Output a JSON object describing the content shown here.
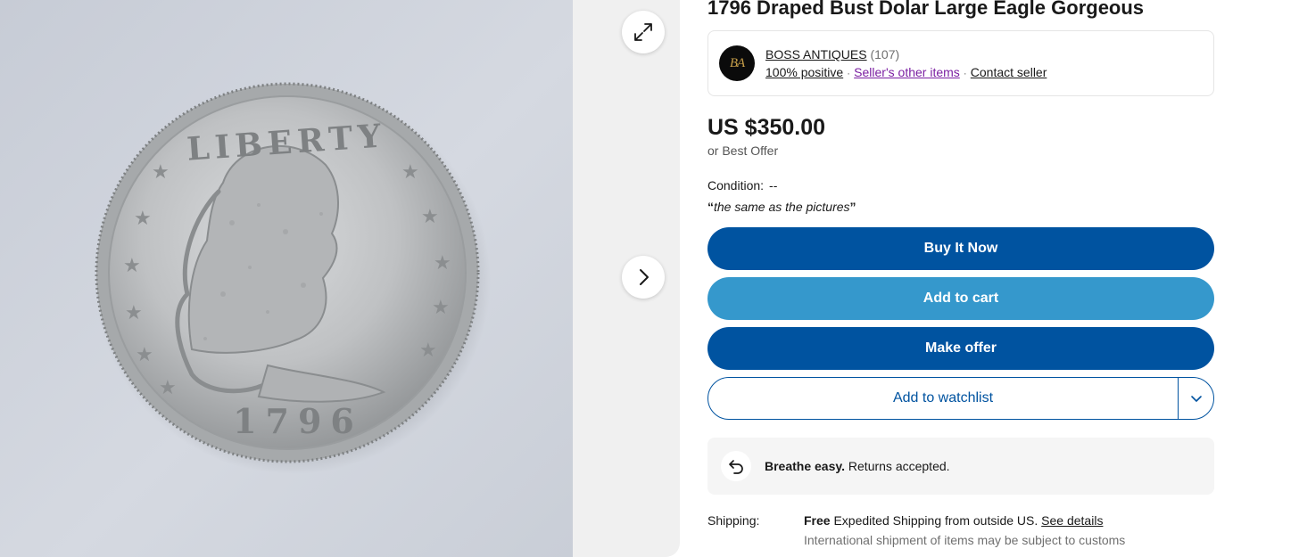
{
  "gallery": {
    "photo": {
      "alt": "1796 Draped Bust Dolar coin",
      "coin_legend": "LIBERTY",
      "coin_date": "1796"
    },
    "expand_icon": "expand-icon",
    "next_icon": "chevron-right-icon"
  },
  "listing": {
    "title": "1796 Draped Bust Dolar Large Eagle Gorgeous",
    "seller": {
      "logo_text": "BA",
      "name": "BOSS ANTIQUES",
      "feedback_count": "(107)",
      "positive": "100% positive",
      "other_items": "Seller's other items",
      "contact": "Contact seller",
      "separator": "·"
    },
    "price": "US $350.00",
    "best_offer": "or Best Offer",
    "condition": {
      "label": "Condition:",
      "value": "--",
      "note": "the same as the pictures",
      "quote_open": "“",
      "quote_close": "”"
    },
    "buttons": {
      "buy_now": "Buy It Now",
      "add_to_cart": "Add to cart",
      "make_offer": "Make offer",
      "add_to_watchlist": "Add to watchlist"
    },
    "returns": {
      "headline": "Breathe easy.",
      "detail": "Returns accepted."
    },
    "shipping": {
      "label": "Shipping:",
      "free": "Free",
      "method": "Expedited Shipping from outside US.",
      "see_details": "See details",
      "note": "International shipment of items may be subject to customs"
    }
  },
  "colors": {
    "primary_button": "#0053a0",
    "secondary_button": "#3598cc",
    "visited_link": "#7b1fa2"
  }
}
